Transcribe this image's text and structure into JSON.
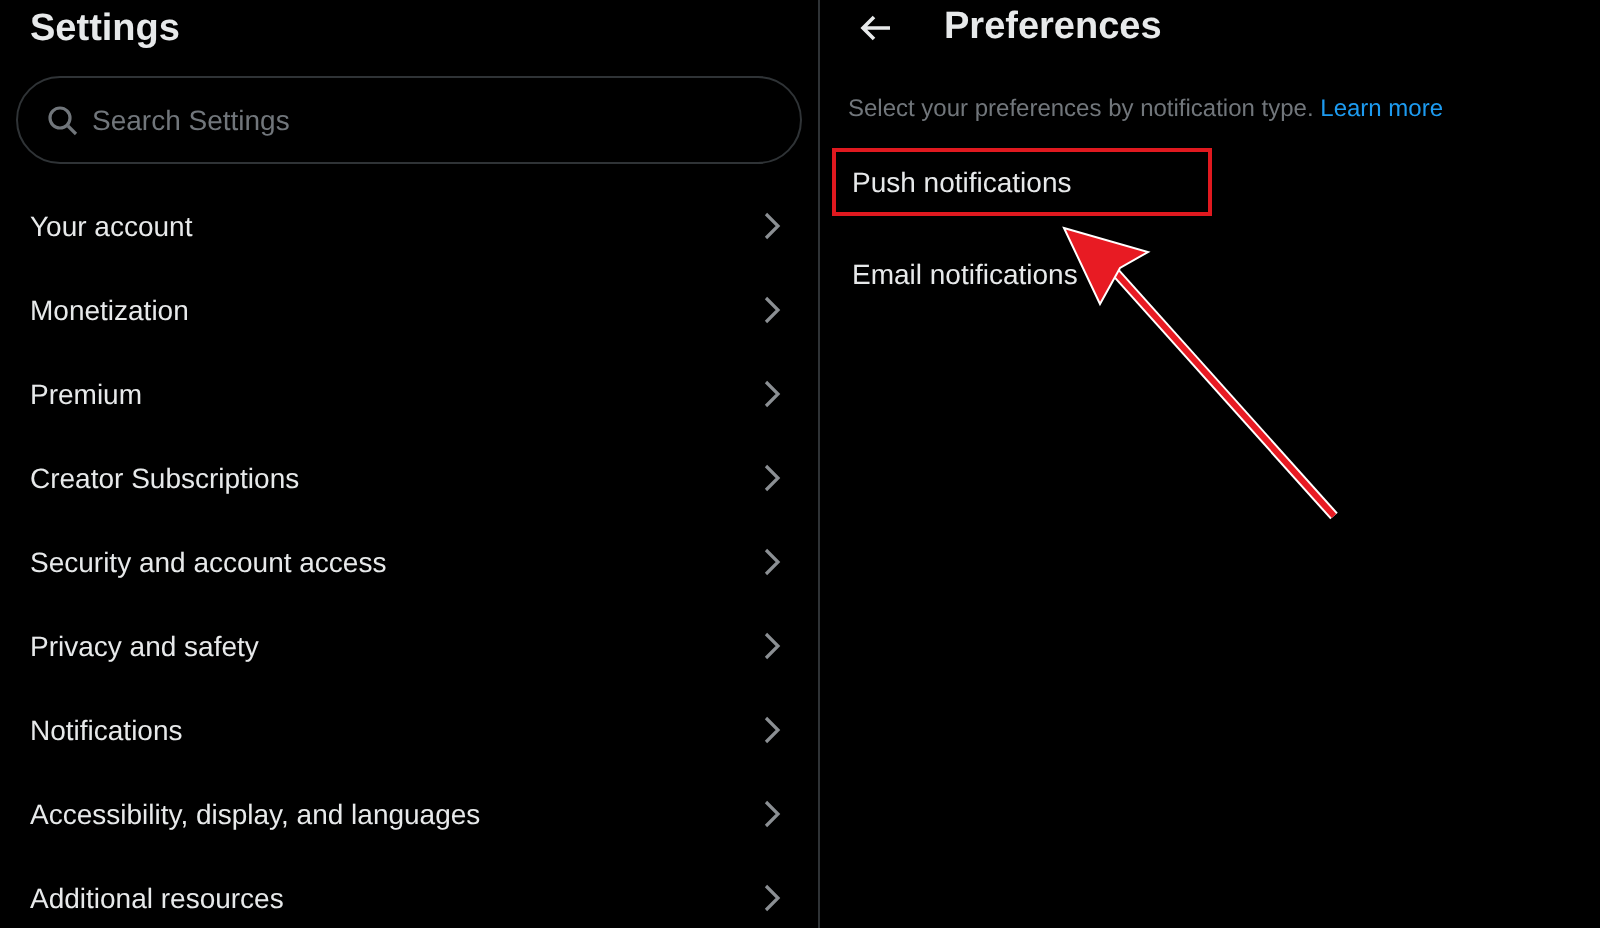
{
  "settings": {
    "title": "Settings",
    "search": {
      "placeholder": "Search Settings"
    },
    "items": [
      {
        "label": "Your account"
      },
      {
        "label": "Monetization"
      },
      {
        "label": "Premium"
      },
      {
        "label": "Creator Subscriptions"
      },
      {
        "label": "Security and account access"
      },
      {
        "label": "Privacy and safety"
      },
      {
        "label": "Notifications"
      },
      {
        "label": "Accessibility, display, and languages"
      },
      {
        "label": "Additional resources"
      }
    ]
  },
  "preferences": {
    "title": "Preferences",
    "description": "Select your preferences by notification type.",
    "link": "Learn more",
    "items": [
      {
        "label": "Push notifications",
        "highlighted": true
      },
      {
        "label": "Email notifications",
        "highlighted": false
      }
    ],
    "annotation": {
      "kind": "arrow"
    }
  }
}
